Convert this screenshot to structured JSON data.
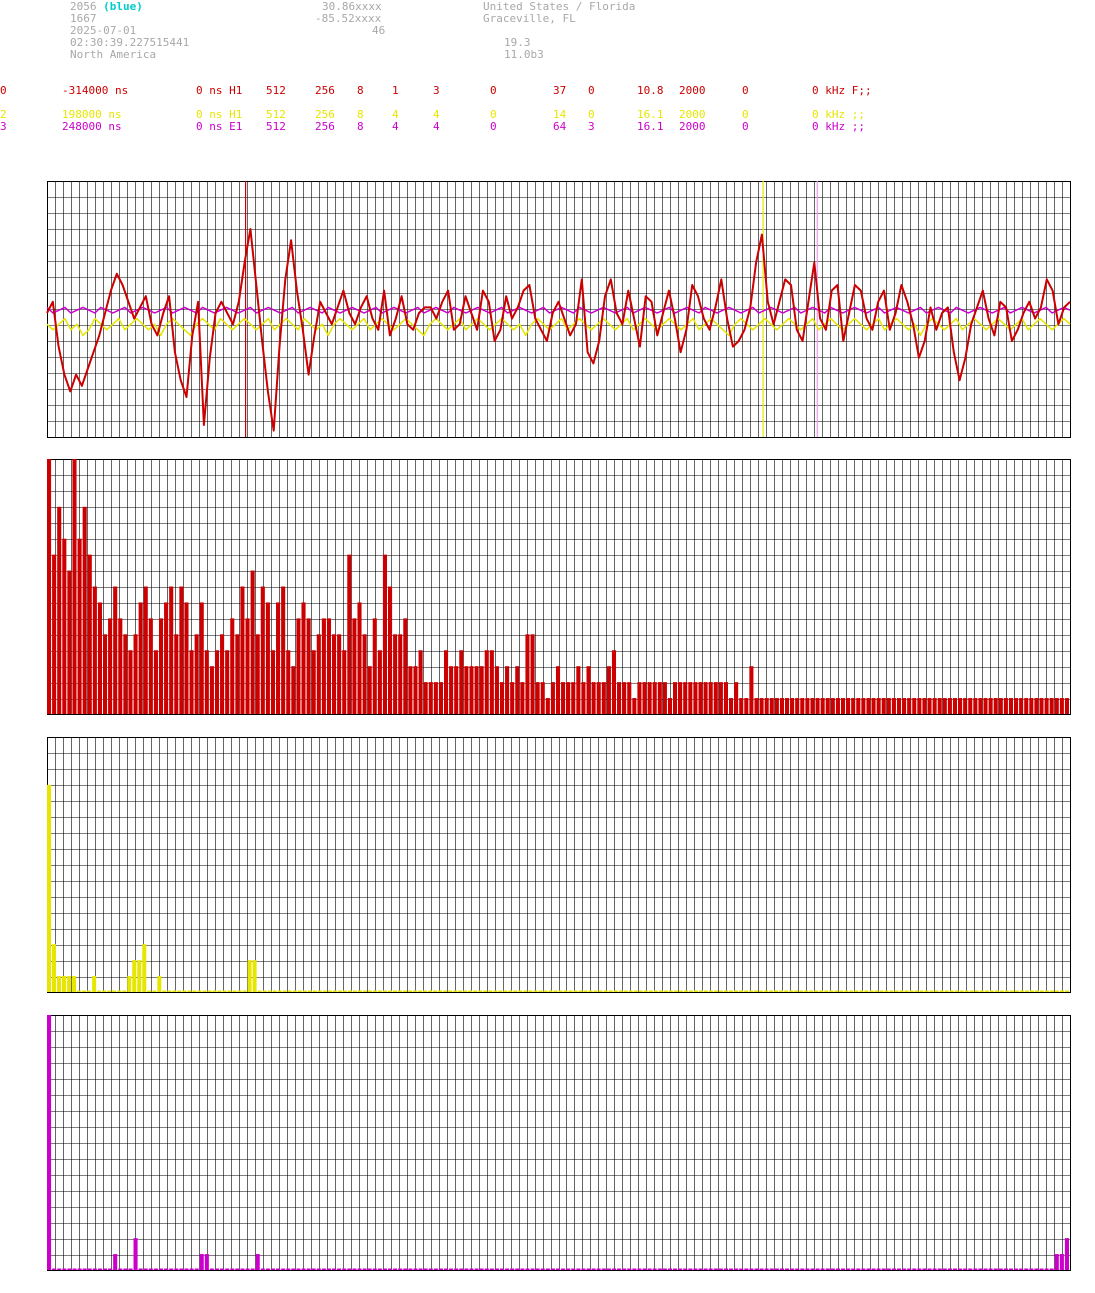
{
  "header": {
    "station": "2056",
    "station_tag": "(blue)",
    "id2": "1667",
    "date": "2025-07-01",
    "time": "02:30:39.227515441",
    "region": "North America",
    "lat": "30.86xxxx",
    "lon": "-85.52xxxx",
    "alt": "46",
    "country": "United States / Florida",
    "city": "Graceville, FL",
    "val1": "19.3",
    "version": "11.0b3"
  },
  "channels": [
    {
      "c": [
        "0",
        "-314000 ns",
        "0 ns H1",
        "512",
        "256",
        "8",
        "1",
        "3",
        "0",
        "37",
        "0",
        "10.8",
        "2000",
        "0",
        "0 kHz F;;"
      ],
      "color": "#cc0000"
    },
    {
      "c": [
        "2",
        "198000 ns",
        "0 ns H1",
        "512",
        "256",
        "8",
        "4",
        "4",
        "0",
        "14",
        "0",
        "16.1",
        "2000",
        "0",
        "0 kHz ;;"
      ],
      "color": "#e6e600"
    },
    {
      "c": [
        "3",
        "248000 ns",
        "0 ns E1",
        "512",
        "256",
        "8",
        "4",
        "4",
        "0",
        "64",
        "3",
        "16.1",
        "2000",
        "0",
        "0 kHz ;;"
      ],
      "color": "#cc00cc"
    }
  ],
  "colors": {
    "red": "#cc0000",
    "yellow": "#e6e600",
    "magenta": "#cc00cc",
    "grid": "#000000"
  },
  "chart_data": [
    {
      "type": "line",
      "panel": "waveform",
      "markers": [
        {
          "x": 33,
          "color": "#cc0000"
        },
        {
          "x": 119,
          "color": "#e6e600"
        },
        {
          "x": 128,
          "color": "#ee99ee"
        }
      ],
      "series": [
        {
          "color": "#cc0000",
          "values": [
            0,
            4,
            -12,
            -22,
            -28,
            -22,
            -26,
            -20,
            -14,
            -8,
            0,
            8,
            14,
            10,
            4,
            -2,
            2,
            6,
            -4,
            -8,
            0,
            6,
            -14,
            -24,
            -30,
            -8,
            4,
            -40,
            -16,
            0,
            4,
            0,
            -4,
            4,
            18,
            30,
            10,
            -10,
            -28,
            -42,
            -12,
            12,
            26,
            8,
            -6,
            -22,
            -8,
            4,
            0,
            -4,
            2,
            8,
            0,
            -4,
            2,
            6,
            -2,
            -6,
            8,
            -8,
            -2,
            6,
            -4,
            -6,
            0,
            2,
            2,
            -2,
            4,
            8,
            -6,
            -4,
            6,
            0,
            -6,
            8,
            4,
            -10,
            -6,
            6,
            -2,
            2,
            8,
            10,
            -2,
            -6,
            -10,
            0,
            4,
            -2,
            -8,
            -4,
            12,
            -14,
            -18,
            -10,
            6,
            12,
            0,
            -4,
            8,
            -2,
            -12,
            6,
            4,
            -8,
            0,
            8,
            -2,
            -14,
            -6,
            10,
            6,
            -2,
            -6,
            2,
            12,
            -2,
            -12,
            -10,
            -6,
            2,
            18,
            28,
            4,
            -4,
            4,
            12,
            10,
            -6,
            -10,
            4,
            18,
            -2,
            -6,
            8,
            10,
            -10,
            0,
            10,
            8,
            -2,
            -6,
            4,
            8,
            -6,
            0,
            10,
            4,
            -4,
            -16,
            -10,
            2,
            -6,
            0,
            2,
            -14,
            -24,
            -16,
            -4,
            2,
            8,
            -2,
            -8,
            4,
            2,
            -10,
            -6,
            0,
            4,
            -2,
            2,
            12,
            8,
            -4,
            2,
            4
          ]
        },
        {
          "color": "#e6e600",
          "values": [
            -4,
            -6,
            -4,
            -2,
            -6,
            -4,
            -8,
            -6,
            -2,
            -4,
            -6,
            -4,
            -2,
            -6,
            -4,
            -2,
            -4,
            -6,
            -4,
            -8,
            -4,
            -2,
            -4,
            -6,
            -8,
            -4,
            -2,
            -4,
            -6,
            -2,
            -4,
            -6,
            -4,
            -2,
            -4,
            -6,
            -4,
            -2,
            -6,
            -4,
            -2,
            -4,
            -6,
            -2,
            -4,
            -6,
            -4,
            -8,
            -4,
            -2,
            -4,
            -6,
            -4,
            -2,
            -6,
            -4,
            -2,
            -4,
            -6,
            -4,
            -2,
            -4,
            -6,
            -8,
            -4,
            -2,
            -4,
            -6,
            -4,
            -2,
            -6,
            -4,
            -2,
            -4,
            -6,
            -4,
            -2,
            -4,
            -6,
            -4,
            -8,
            -4,
            -2,
            -4,
            -6,
            -4,
            -2,
            -6,
            -4,
            -2,
            -4,
            -6,
            -4,
            -2,
            -4,
            -6,
            -4,
            -2,
            -6,
            -4,
            -2,
            -4,
            -6,
            -4,
            -2,
            -4,
            -6,
            -4,
            -2,
            -6,
            -4,
            -2,
            -4,
            -6,
            -8,
            -4,
            -2,
            -4,
            -6,
            -4,
            -2,
            -4,
            -6,
            -4,
            -2,
            -4,
            -6,
            -4,
            -2,
            -6,
            -4,
            -2,
            -4,
            -6,
            -4,
            -2,
            -4,
            -6,
            -4,
            -2,
            -6,
            -4,
            -2,
            -4,
            -6,
            -4,
            -8,
            -4,
            -2,
            -4,
            -6,
            -4,
            -2,
            -6,
            -4,
            -2,
            -4,
            -6,
            -4,
            -2,
            -4,
            -6,
            -4,
            -2,
            -6,
            -4,
            -2,
            -4,
            -6,
            -4,
            -2,
            -4
          ]
        },
        {
          "color": "#cc00cc",
          "values": [
            2,
            0,
            1,
            2,
            0,
            1,
            2,
            1,
            0,
            2,
            1,
            0,
            1,
            2,
            0,
            1,
            2,
            1,
            0,
            1,
            2,
            0,
            1,
            2,
            1,
            0,
            2,
            1,
            0,
            1,
            2,
            1,
            0,
            1,
            2,
            0,
            1,
            2,
            1,
            0,
            1,
            2,
            0,
            1,
            2,
            1,
            0,
            2,
            1,
            0,
            1,
            2,
            1,
            0,
            1,
            2,
            0,
            1,
            2,
            1,
            0,
            1,
            2,
            0,
            1,
            2,
            1,
            0,
            2,
            1,
            0,
            1,
            2,
            1,
            0,
            1,
            2,
            0,
            1,
            2,
            1,
            0,
            1,
            2,
            0,
            1,
            2,
            1,
            0,
            2,
            1,
            0,
            1,
            2,
            1,
            0,
            1,
            2,
            0,
            1,
            2,
            1,
            0,
            1,
            2,
            0,
            1,
            2,
            1,
            0,
            2,
            1,
            0,
            1,
            2,
            1,
            0,
            1,
            2,
            0,
            1,
            2,
            1,
            0,
            1,
            2,
            0,
            1,
            2,
            1,
            0,
            2,
            1,
            0,
            1,
            2,
            1,
            0,
            1,
            2,
            0,
            1,
            2,
            1,
            0,
            1,
            2,
            0,
            1,
            2,
            1,
            0,
            2,
            1,
            0,
            1,
            2,
            1,
            0,
            1,
            2,
            0,
            1,
            2,
            1,
            0,
            1,
            2,
            0,
            1,
            2,
            1
          ]
        }
      ]
    },
    {
      "type": "bar",
      "panel": "spectrum-1",
      "color": "#cc0000",
      "values": [
        16,
        10,
        13,
        11,
        9,
        16,
        11,
        13,
        10,
        8,
        7,
        5,
        6,
        8,
        6,
        5,
        4,
        5,
        7,
        8,
        6,
        4,
        6,
        7,
        8,
        5,
        8,
        7,
        4,
        5,
        7,
        4,
        3,
        4,
        5,
        4,
        6,
        5,
        8,
        6,
        9,
        5,
        8,
        7,
        4,
        7,
        8,
        4,
        3,
        6,
        7,
        6,
        4,
        5,
        6,
        6,
        5,
        5,
        4,
        10,
        6,
        7,
        5,
        3,
        6,
        4,
        10,
        8,
        5,
        5,
        6,
        3,
        3,
        4,
        2,
        2,
        2,
        2,
        4,
        3,
        3,
        4,
        3,
        3,
        3,
        3,
        4,
        4,
        3,
        2,
        3,
        2,
        3,
        2,
        5,
        5,
        2,
        2,
        1,
        2,
        3,
        2,
        2,
        2,
        3,
        2,
        3,
        2,
        2,
        2,
        3,
        4,
        2,
        2,
        2,
        1,
        2,
        2,
        2,
        2,
        2,
        2,
        1,
        2,
        2,
        2,
        2,
        2,
        2,
        2,
        2,
        2,
        2,
        2,
        1,
        2,
        1,
        1,
        3,
        1,
        1,
        1,
        1,
        1,
        1,
        1,
        1,
        1,
        1,
        1,
        1,
        1,
        1,
        1,
        1,
        1,
        1,
        1,
        1,
        1,
        1,
        1,
        1,
        1,
        1,
        1,
        1,
        1,
        1,
        1,
        1,
        1,
        1,
        1,
        1,
        1,
        1,
        1,
        1,
        1,
        1,
        1,
        1,
        1,
        1,
        1,
        1,
        1,
        1,
        1,
        1,
        1,
        1,
        1,
        1,
        1,
        1,
        1,
        1,
        1,
        1
      ]
    },
    {
      "type": "bar",
      "panel": "spectrum-2",
      "color": "#e6e600",
      "values": [
        13,
        3,
        1,
        1,
        1,
        1,
        0,
        0,
        0,
        1,
        0,
        0,
        0,
        0,
        0,
        0,
        1,
        2,
        2,
        3,
        0,
        0,
        1,
        0,
        0,
        0,
        0,
        0,
        0,
        0,
        0,
        0,
        0,
        0,
        0,
        0,
        0,
        0,
        0,
        0,
        2,
        2,
        0,
        0,
        0,
        0,
        0,
        0,
        0,
        0,
        0,
        0,
        0,
        0,
        0,
        0,
        0,
        0,
        0,
        0,
        0,
        0,
        0,
        0,
        0,
        0,
        0,
        0,
        0,
        0,
        0,
        0,
        0,
        0,
        0,
        0,
        0,
        0,
        0,
        0,
        0,
        0,
        0,
        0,
        0,
        0,
        0,
        0,
        0,
        0,
        0,
        0,
        0,
        0,
        0,
        0,
        0,
        0,
        0,
        0,
        0,
        0,
        0,
        0,
        0,
        0,
        0,
        0,
        0,
        0,
        0,
        0,
        0,
        0,
        0,
        0,
        0,
        0,
        0,
        0,
        0,
        0,
        0,
        0,
        0,
        0,
        0,
        0,
        0,
        0,
        0,
        0,
        0,
        0,
        0,
        0,
        0,
        0,
        0,
        0,
        0,
        0,
        0,
        0,
        0,
        0,
        0,
        0,
        0,
        0,
        0,
        0,
        0,
        0,
        0,
        0,
        0,
        0,
        0,
        0,
        0,
        0,
        0,
        0,
        0,
        0,
        0,
        0,
        0,
        0,
        0,
        0,
        0,
        0,
        0,
        0,
        0,
        0,
        0,
        0,
        0,
        0,
        0,
        0,
        0,
        0,
        0,
        0,
        0,
        0,
        0,
        0,
        0,
        0,
        0,
        0,
        0,
        0,
        0,
        0,
        0,
        0,
        0,
        0
      ]
    },
    {
      "type": "bar",
      "panel": "spectrum-3",
      "color": "#cc00cc",
      "values": [
        16,
        0,
        0,
        0,
        0,
        0,
        0,
        0,
        0,
        0,
        0,
        0,
        0,
        1,
        0,
        0,
        0,
        2,
        0,
        0,
        0,
        0,
        0,
        0,
        0,
        0,
        0,
        0,
        0,
        0,
        1,
        1,
        0,
        0,
        0,
        0,
        0,
        0,
        0,
        0,
        0,
        1,
        0,
        0,
        0,
        0,
        0,
        0,
        0,
        0,
        0,
        0,
        0,
        0,
        0,
        0,
        0,
        0,
        0,
        0,
        0,
        0,
        0,
        0,
        0,
        0,
        0,
        0,
        0,
        0,
        0,
        0,
        0,
        0,
        0,
        0,
        0,
        0,
        0,
        0,
        0,
        0,
        0,
        0,
        0,
        0,
        0,
        0,
        0,
        0,
        0,
        0,
        0,
        0,
        0,
        0,
        0,
        0,
        0,
        0,
        0,
        0,
        0,
        0,
        0,
        0,
        0,
        0,
        0,
        0,
        0,
        0,
        0,
        0,
        0,
        0,
        0,
        0,
        0,
        0,
        0,
        0,
        0,
        0,
        0,
        0,
        0,
        0,
        0,
        0,
        0,
        0,
        0,
        0,
        0,
        0,
        0,
        0,
        0,
        0,
        0,
        0,
        0,
        0,
        0,
        0,
        0,
        0,
        0,
        0,
        0,
        0,
        0,
        0,
        0,
        0,
        0,
        0,
        0,
        0,
        0,
        0,
        0,
        0,
        0,
        0,
        0,
        0,
        0,
        0,
        0,
        0,
        0,
        0,
        0,
        0,
        0,
        0,
        0,
        0,
        0,
        0,
        0,
        0,
        0,
        0,
        0,
        0,
        0,
        0,
        0,
        0,
        0,
        0,
        0,
        0,
        0,
        0,
        1,
        1,
        2
      ]
    }
  ]
}
